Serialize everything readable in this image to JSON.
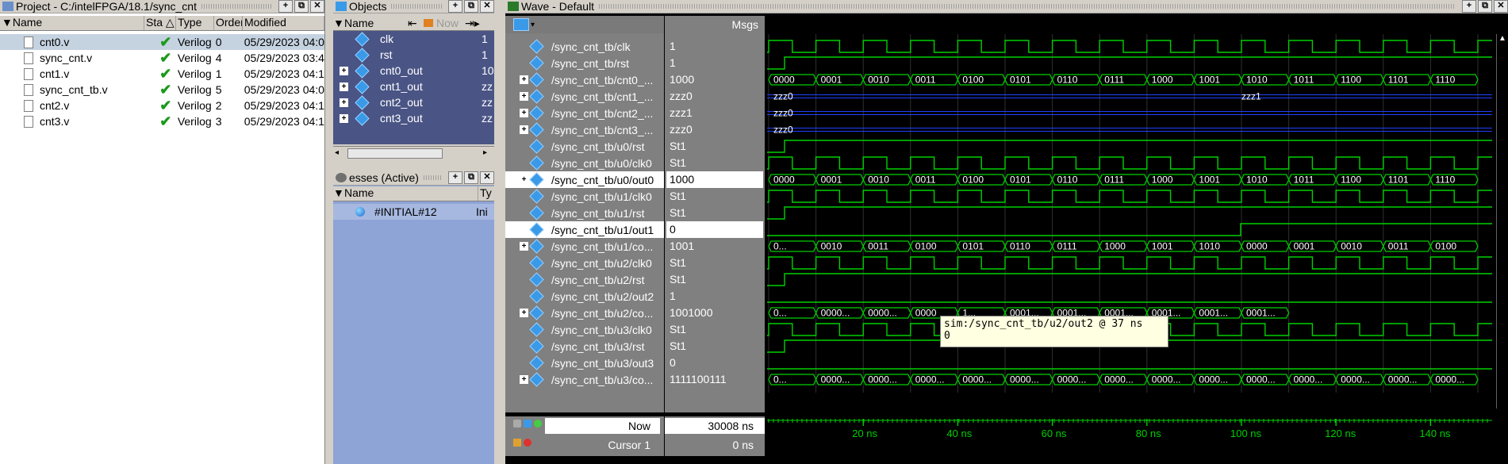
{
  "project": {
    "title": "Project - C:/intelFPGA/18.1/sync_cnt",
    "columns": [
      "Name",
      "Sta",
      "Type",
      "Order",
      "Modified"
    ],
    "files": [
      {
        "name": "cnt0.v",
        "status": "✔",
        "type": "Verilog",
        "order": "0",
        "modified": "05/29/2023 04:0"
      },
      {
        "name": "sync_cnt.v",
        "status": "✔",
        "type": "Verilog",
        "order": "4",
        "modified": "05/29/2023 03:4"
      },
      {
        "name": "cnt1.v",
        "status": "✔",
        "type": "Verilog",
        "order": "1",
        "modified": "05/29/2023 04:1"
      },
      {
        "name": "sync_cnt_tb.v",
        "status": "✔",
        "type": "Verilog",
        "order": "5",
        "modified": "05/29/2023 04:0"
      },
      {
        "name": "cnt2.v",
        "status": "✔",
        "type": "Verilog",
        "order": "2",
        "modified": "05/29/2023 04:1"
      },
      {
        "name": "cnt3.v",
        "status": "✔",
        "type": "Verilog",
        "order": "3",
        "modified": "05/29/2023 04:1"
      }
    ]
  },
  "objects": {
    "title": "Objects",
    "col_name": "Name",
    "col_now": "Now",
    "items": [
      {
        "name": "clk",
        "value": "1"
      },
      {
        "name": "rst",
        "value": "1"
      },
      {
        "name": "cnt0_out",
        "value": "10"
      },
      {
        "name": "cnt1_out",
        "value": "zz"
      },
      {
        "name": "cnt2_out",
        "value": "zz"
      },
      {
        "name": "cnt3_out",
        "value": "zz"
      }
    ]
  },
  "processes": {
    "title": "esses (Active)",
    "col_name": "Name",
    "col_type": "Ty",
    "items": [
      {
        "name": "#INITIAL#12",
        "type": "Ini"
      }
    ]
  },
  "wave": {
    "title": "Wave - Default",
    "msgs_label": "Msgs",
    "signals": [
      {
        "name": "/sync_cnt_tb/clk",
        "value": "1"
      },
      {
        "name": "/sync_cnt_tb/rst",
        "value": "1"
      },
      {
        "name": "/sync_cnt_tb/cnt0_...",
        "value": "1000"
      },
      {
        "name": "/sync_cnt_tb/cnt1_...",
        "value": "zzz0"
      },
      {
        "name": "/sync_cnt_tb/cnt2_...",
        "value": "zzz1"
      },
      {
        "name": "/sync_cnt_tb/cnt3_...",
        "value": "zzz0"
      },
      {
        "name": "/sync_cnt_tb/u0/rst",
        "value": "St1"
      },
      {
        "name": "/sync_cnt_tb/u0/clk0",
        "value": "St1"
      },
      {
        "name": "/sync_cnt_tb/u0/out0",
        "value": "1000"
      },
      {
        "name": "/sync_cnt_tb/u1/clk0",
        "value": "St1"
      },
      {
        "name": "/sync_cnt_tb/u1/rst",
        "value": "St1"
      },
      {
        "name": "/sync_cnt_tb/u1/out1",
        "value": "0"
      },
      {
        "name": "/sync_cnt_tb/u1/co...",
        "value": "1001"
      },
      {
        "name": "/sync_cnt_tb/u2/clk0",
        "value": "St1"
      },
      {
        "name": "/sync_cnt_tb/u2/rst",
        "value": "St1"
      },
      {
        "name": "/sync_cnt_tb/u2/out2",
        "value": "1"
      },
      {
        "name": "/sync_cnt_tb/u2/co...",
        "value": "1001000"
      },
      {
        "name": "/sync_cnt_tb/u3/clk0",
        "value": "St1"
      },
      {
        "name": "/sync_cnt_tb/u3/rst",
        "value": "St1"
      },
      {
        "name": "/sync_cnt_tb/u3/out3",
        "value": "0"
      },
      {
        "name": "/sync_cnt_tb/u3/co...",
        "value": "1111100111"
      }
    ],
    "bus_labels": {
      "cnt0": [
        "0000",
        "0001",
        "0010",
        "0011",
        "0100",
        "0101",
        "0110",
        "0111",
        "1000",
        "1001",
        "1010",
        "1011",
        "1100",
        "1101",
        "1110"
      ],
      "cnt1": [
        "zzz0",
        "zzz1"
      ],
      "cnt2": [
        "zzz0"
      ],
      "cnt3": [
        "zzz0"
      ],
      "u1co": [
        "0...",
        "0010",
        "0011",
        "0100",
        "0101",
        "0110",
        "0111",
        "1000",
        "1001",
        "1010",
        "0000",
        "0001",
        "0010",
        "0011",
        "0100"
      ],
      "u2co": [
        "0...",
        "0000...",
        "0000...",
        "0000",
        "1...",
        "0001...",
        "0001...",
        "0001...",
        "0001...",
        "0001...",
        "0001..."
      ],
      "u3co": [
        "0...",
        "0000...",
        "0000...",
        "0000...",
        "0000...",
        "0000...",
        "0000...",
        "0000...",
        "0000...",
        "0000...",
        "0000...",
        "0000...",
        "0000...",
        "0000...",
        "0000..."
      ]
    },
    "tooltip": {
      "line1": "sim:/sync_cnt_tb/u2/out2 @ 37 ns",
      "line2": "0"
    },
    "now_label": "Now",
    "now_value": "30008 ns",
    "cursor_label": "Cursor 1",
    "cursor_value": "0 ns",
    "time_ticks": [
      "20 ns",
      "40 ns",
      "60 ns",
      "80 ns",
      "100 ns",
      "120 ns",
      "140 ns"
    ]
  }
}
